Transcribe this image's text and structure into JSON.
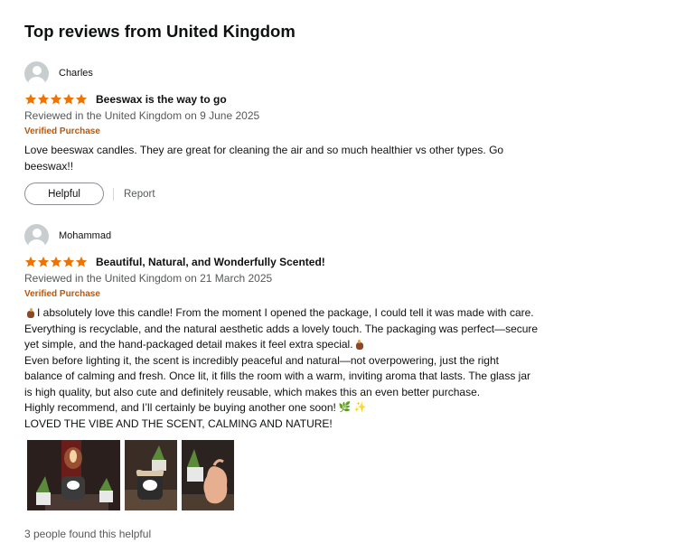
{
  "section_title": "Top reviews from United Kingdom",
  "colors": {
    "star": "#f07300",
    "verified": "#c45500",
    "muted": "#565959"
  },
  "reviews": [
    {
      "author": "Charles",
      "rating": 5,
      "title": "Beeswax is the way to go",
      "date": "Reviewed in the United Kingdom on 9 June 2025",
      "verified": "Verified Purchase",
      "body": [
        "Love beeswax candles. They are great for cleaning the air and so much healthier vs other types. Go",
        "beeswax!!"
      ],
      "helpful_label": "Helpful",
      "report_label": "Report"
    },
    {
      "author": "Mohammad",
      "rating": 5,
      "title": "Beautiful, Natural, and Wonderfully Scented!",
      "date": "Reviewed in the United Kingdom on 21 March 2025",
      "verified": "Verified Purchase",
      "body": [
        "I absolutely love this candle! From the moment I opened the package, I could tell it was made with care.",
        "Everything is recyclable, and the natural aesthetic adds a lovely touch. The packaging was perfect—secure",
        "yet simple, and the hand-packaged detail makes it feel extra special.",
        "Even before lighting it, the scent is incredibly peaceful and natural—not overpowering, just the right",
        "balance of calming and fresh. Once lit, it fills the room with a warm, inviting aroma that lasts. The glass jar",
        "is high quality, but also cute and definitely reusable, which makes this an even better purchase.",
        "Highly recommend, and I’ll certainly be buying another one soon!",
        "LOVED THE VIBE AND THE SCENT, CALMING AND NATURE!"
      ],
      "emoji": {
        "candle": "candle-emoji-icon",
        "herb": "🌿",
        "sparkle": "✨"
      },
      "found_helpful": "3 people found this helpful"
    }
  ]
}
